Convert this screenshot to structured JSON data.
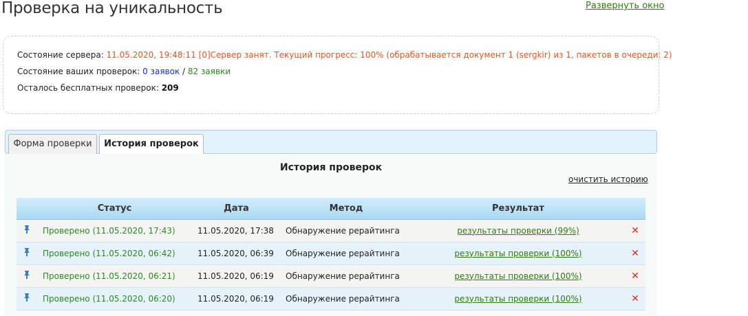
{
  "header": {
    "title": "Проверка на уникальность",
    "expand_link": "Развернуть окно"
  },
  "status": {
    "server_label": "Состояние сервера: ",
    "server_value": "11.05.2020, 19:48:11 [0]Сервер занят. Текущий прогресс: 100% (обрабатывается документ 1 (sergkir) из 1, пакетов в очереди: 2)",
    "checks_label": "Состояние ваших проверок: ",
    "checks_pending": "0 заявок",
    "checks_separator": " / ",
    "checks_done": "82 заявки",
    "free_label": "Осталось бесплатных проверок: ",
    "free_value": "209"
  },
  "tabs": [
    {
      "label": "Форма проверки",
      "active": false
    },
    {
      "label": "История проверок",
      "active": true
    }
  ],
  "history": {
    "title": "История проверок",
    "clear_link": "очистить историю",
    "columns": [
      "Статус",
      "Дата",
      "Метод",
      "Результат"
    ],
    "rows": [
      {
        "status": "Проверено (11.05.2020, 17:43)",
        "date": "11.05.2020, 17:38",
        "method": "Обнаружение рерайтинга",
        "result": "результаты проверки (99%)"
      },
      {
        "status": "Проверено (11.05.2020, 06:42)",
        "date": "11.05.2020, 06:39",
        "method": "Обнаружение рерайтинга",
        "result": "результаты проверки (100%)"
      },
      {
        "status": "Проверено (11.05.2020, 06:21)",
        "date": "11.05.2020, 06:19",
        "method": "Обнаружение рерайтинга",
        "result": "результаты проверки (100%)"
      },
      {
        "status": "Проверено (11.05.2020, 06:20)",
        "date": "11.05.2020, 06:19",
        "method": "Обнаружение рерайтинга",
        "result": "результаты проверки (100%)"
      }
    ],
    "delete_icon": "✕"
  },
  "colors": {
    "accent_green": "#2a8a1f",
    "server_orange": "#e8541c",
    "pending_blue": "#1a2ee6",
    "delete_red": "#e02a1a"
  }
}
